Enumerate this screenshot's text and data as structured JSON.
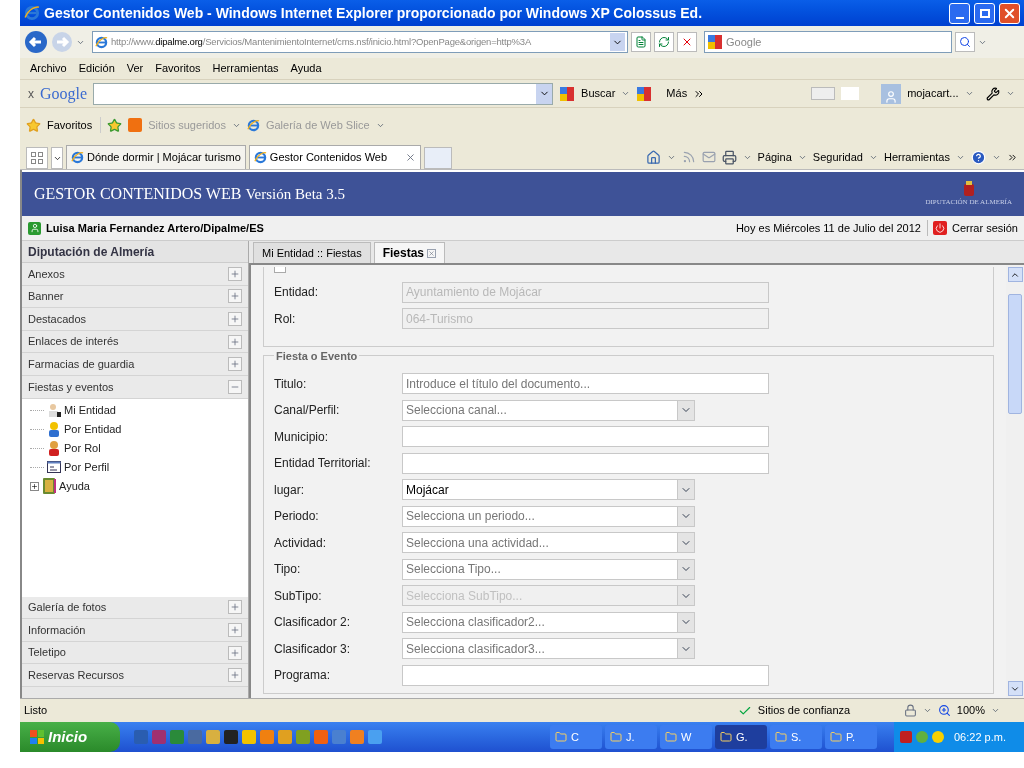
{
  "window": {
    "title": "Gestor Contenidos Web - Windows Internet Explorer proporcionado por Windows XP Colossus Ed."
  },
  "address_bar": {
    "prefix": "http://www.",
    "domain": "dipalme.org",
    "path": "/Servicios/MantenimientoInternet/cms.nsf/inicio.html?OpenPage&origen=http%3A"
  },
  "search_box": {
    "placeholder": "Google"
  },
  "menu": [
    "Archivo",
    "Edición",
    "Ver",
    "Favoritos",
    "Herramientas",
    "Ayuda"
  ],
  "google_toolbar": {
    "close": "x",
    "logo": "Google",
    "search_button": "Buscar",
    "more": "Más",
    "account": "mojacart..."
  },
  "favorites_bar": {
    "favorites": "Favoritos",
    "items": [
      "Sitios sugeridos",
      "Galería de Web Slice"
    ]
  },
  "tabs": [
    {
      "label": "Dónde dormir | Mojácar turismo",
      "selected": false
    },
    {
      "label": "Gestor Contenidos Web",
      "selected": true
    }
  ],
  "command_bar": [
    "Página",
    "Seguridad",
    "Herramientas"
  ],
  "app": {
    "title": "GESTOR CONTENIDOS WEB",
    "version": "Versión Beta 3.5",
    "org": "DIPUTACIÓN DE ALMERÍA",
    "user": "Luisa Maria Fernandez Artero/Dipalme/ES",
    "date": "Hoy es Miércoles 11 de Julio del 2012",
    "logout": "Cerrar sesión"
  },
  "sidebar": {
    "title": "Diputación de Almería",
    "sections": [
      {
        "label": "Anexos",
        "expanded": false
      },
      {
        "label": "Banner",
        "expanded": false
      },
      {
        "label": "Destacados",
        "expanded": false
      },
      {
        "label": "Enlaces de interés",
        "expanded": false
      },
      {
        "label": "Farmacias de guardia",
        "expanded": false
      },
      {
        "label": "Fiestas y eventos",
        "expanded": true,
        "children": [
          {
            "label": "Mi Entidad",
            "kind": "entity"
          },
          {
            "label": "Por Entidad",
            "kind": "person"
          },
          {
            "label": "Por Rol",
            "kind": "role"
          },
          {
            "label": "Por Perfil",
            "kind": "profile"
          },
          {
            "label": "Ayuda",
            "kind": "book",
            "expanded": false
          }
        ]
      },
      {
        "label": "Galería de fotos",
        "expanded": false
      },
      {
        "label": "Información",
        "expanded": false
      },
      {
        "label": "Teletipo",
        "expanded": false
      },
      {
        "label": "Reservas Recursos",
        "expanded": false
      }
    ]
  },
  "content_tabs": [
    {
      "label": "Mi Entidad :: Fiestas",
      "selected": false,
      "closable": false
    },
    {
      "label": "Fiestas",
      "selected": true,
      "closable": true
    }
  ],
  "security_fields": [
    {
      "label": "Entidad:",
      "kind": "text",
      "value": "Ayuntamiento de Mojácar",
      "disabled": true
    },
    {
      "label": "Rol:",
      "kind": "text",
      "value": "064-Turismo",
      "disabled": true
    }
  ],
  "event_section": {
    "legend": "Fiesta o Evento",
    "fields": [
      {
        "label": "Titulo:",
        "kind": "text",
        "placeholder": "Introduce el título del documento...",
        "disabled": false
      },
      {
        "label": "Canal/Perfil:",
        "kind": "select",
        "placeholder": "Selecciona canal...",
        "disabled": false
      },
      {
        "label": "Municipio:",
        "kind": "text",
        "disabled": false
      },
      {
        "label": "Entidad Territorial:",
        "kind": "text",
        "disabled": false
      },
      {
        "label": "lugar:",
        "kind": "select",
        "value": "Mojácar",
        "disabled": false
      },
      {
        "label": "Periodo:",
        "kind": "select",
        "placeholder": "Selecciona un periodo...",
        "disabled": false
      },
      {
        "label": "Actividad:",
        "kind": "select",
        "placeholder": "Selecciona una actividad...",
        "disabled": false
      },
      {
        "label": "Tipo:",
        "kind": "select",
        "placeholder": "Selecciona Tipo...",
        "disabled": false
      },
      {
        "label": "SubTipo:",
        "kind": "select",
        "placeholder": "Selecciona SubTipo...",
        "disabled": true
      },
      {
        "label": "Clasificador 2:",
        "kind": "select",
        "placeholder": "Selecciona clasificador2...",
        "disabled": false
      },
      {
        "label": "Clasificador 3:",
        "kind": "select",
        "placeholder": "Selecciona clasificador3...",
        "disabled": false
      },
      {
        "label": "Programa:",
        "kind": "text",
        "disabled": false
      }
    ]
  },
  "status_bar": {
    "text": "Listo",
    "zone": "Sitios de confianza",
    "zoom": "100%"
  },
  "taskbar": {
    "start": "Inicio",
    "tasks": [
      {
        "label": "C",
        "selected": false
      },
      {
        "label": "J.",
        "selected": false
      },
      {
        "label": "W",
        "selected": false
      },
      {
        "label": "G.",
        "selected": true
      },
      {
        "label": "S.",
        "selected": false
      },
      {
        "label": "P.",
        "selected": false
      }
    ],
    "clock": "06:22 p.m."
  }
}
